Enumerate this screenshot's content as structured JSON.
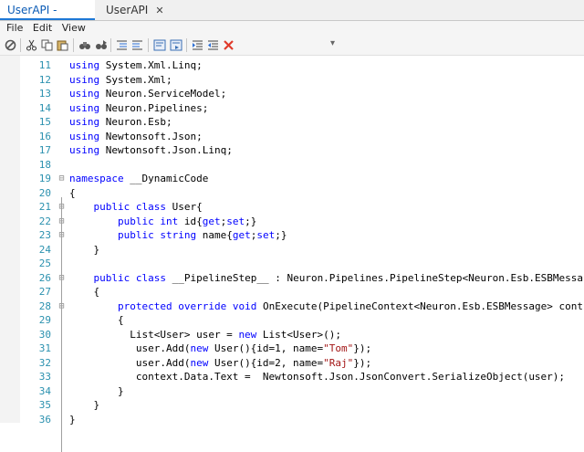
{
  "tabs": [
    {
      "label": "UserAPI - Get",
      "close": "✕"
    },
    {
      "label": "UserAPI",
      "close": "✕"
    }
  ],
  "menu": [
    "File",
    "Edit",
    "View"
  ],
  "toolbar_icons": [
    "no-icon",
    "cut-icon",
    "copy-icon",
    "paste-icon",
    "find-icon",
    "find-next-icon",
    "comment-icon",
    "uncomment-icon",
    "bookmark-icon",
    "bookmark-next-icon",
    "indent-icon",
    "outdent-icon",
    "delete-icon"
  ],
  "toolbar_chevron": "▾",
  "colors": {
    "keyword": "#0000ff",
    "string": "#a31515",
    "linenumber": "#2b91af",
    "tab_active": "#0b5bb5"
  },
  "code_lines": [
    {
      "n": "11",
      "fold": "",
      "segs": [
        {
          "t": "using",
          "k": "kw"
        },
        {
          "t": " System.Xml.Linq;",
          "k": ""
        }
      ]
    },
    {
      "n": "12",
      "fold": "",
      "segs": [
        {
          "t": "using",
          "k": "kw"
        },
        {
          "t": " System.Xml;",
          "k": ""
        }
      ]
    },
    {
      "n": "13",
      "fold": "",
      "segs": [
        {
          "t": "using",
          "k": "kw"
        },
        {
          "t": " Neuron.ServiceModel;",
          "k": ""
        }
      ]
    },
    {
      "n": "14",
      "fold": "",
      "segs": [
        {
          "t": "using",
          "k": "kw"
        },
        {
          "t": " Neuron.Pipelines;",
          "k": ""
        }
      ]
    },
    {
      "n": "15",
      "fold": "",
      "segs": [
        {
          "t": "using",
          "k": "kw"
        },
        {
          "t": " Neuron.Esb;",
          "k": ""
        }
      ]
    },
    {
      "n": "16",
      "fold": "",
      "segs": [
        {
          "t": "using",
          "k": "kw"
        },
        {
          "t": " Newtonsoft.Json;",
          "k": ""
        }
      ]
    },
    {
      "n": "17",
      "fold": "",
      "segs": [
        {
          "t": "using",
          "k": "kw"
        },
        {
          "t": " Newtonsoft.Json.Linq;",
          "k": ""
        }
      ]
    },
    {
      "n": "18",
      "fold": "",
      "segs": []
    },
    {
      "n": "19",
      "fold": "⊟",
      "segs": [
        {
          "t": "namespace",
          "k": "kw"
        },
        {
          "t": " __DynamicCode",
          "k": ""
        }
      ]
    },
    {
      "n": "20",
      "fold": "",
      "segs": [
        {
          "t": "{",
          "k": ""
        }
      ]
    },
    {
      "n": "21",
      "fold": "⊟",
      "segs": [
        {
          "t": "    ",
          "k": ""
        },
        {
          "t": "public",
          "k": "kw"
        },
        {
          "t": " ",
          "k": ""
        },
        {
          "t": "class",
          "k": "kw"
        },
        {
          "t": " User{",
          "k": ""
        }
      ]
    },
    {
      "n": "22",
      "fold": "⊟",
      "segs": [
        {
          "t": "        ",
          "k": ""
        },
        {
          "t": "public",
          "k": "kw"
        },
        {
          "t": " ",
          "k": ""
        },
        {
          "t": "int",
          "k": "kw"
        },
        {
          "t": " id{",
          "k": ""
        },
        {
          "t": "get",
          "k": "kw"
        },
        {
          "t": ";",
          "k": ""
        },
        {
          "t": "set",
          "k": "kw"
        },
        {
          "t": ";}",
          "k": ""
        }
      ]
    },
    {
      "n": "23",
      "fold": "⊟",
      "segs": [
        {
          "t": "        ",
          "k": ""
        },
        {
          "t": "public",
          "k": "kw"
        },
        {
          "t": " ",
          "k": ""
        },
        {
          "t": "string",
          "k": "kw"
        },
        {
          "t": " name{",
          "k": ""
        },
        {
          "t": "get",
          "k": "kw"
        },
        {
          "t": ";",
          "k": ""
        },
        {
          "t": "set",
          "k": "kw"
        },
        {
          "t": ";}",
          "k": ""
        }
      ]
    },
    {
      "n": "24",
      "fold": "",
      "segs": [
        {
          "t": "    }",
          "k": ""
        }
      ]
    },
    {
      "n": "25",
      "fold": "",
      "segs": []
    },
    {
      "n": "26",
      "fold": "⊟",
      "segs": [
        {
          "t": "    ",
          "k": ""
        },
        {
          "t": "public",
          "k": "kw"
        },
        {
          "t": " ",
          "k": ""
        },
        {
          "t": "class",
          "k": "kw"
        },
        {
          "t": " __PipelineStep__ : Neuron.Pipelines.PipelineStep<Neuron.Esb.ESBMessa",
          "k": ""
        }
      ]
    },
    {
      "n": "27",
      "fold": "",
      "segs": [
        {
          "t": "    {",
          "k": ""
        }
      ]
    },
    {
      "n": "28",
      "fold": "⊟",
      "segs": [
        {
          "t": "        ",
          "k": ""
        },
        {
          "t": "protected",
          "k": "kw"
        },
        {
          "t": " ",
          "k": ""
        },
        {
          "t": "override",
          "k": "kw"
        },
        {
          "t": " ",
          "k": ""
        },
        {
          "t": "void",
          "k": "kw"
        },
        {
          "t": " OnExecute(PipelineContext<Neuron.Esb.ESBMessage> cont",
          "k": ""
        }
      ]
    },
    {
      "n": "29",
      "fold": "",
      "segs": [
        {
          "t": "        {",
          "k": ""
        }
      ]
    },
    {
      "n": "30",
      "fold": "",
      "segs": [
        {
          "t": "          List<User> user = ",
          "k": ""
        },
        {
          "t": "new",
          "k": "kw"
        },
        {
          "t": " List<User>();",
          "k": ""
        }
      ]
    },
    {
      "n": "31",
      "fold": "",
      "segs": [
        {
          "t": "           user.Add(",
          "k": ""
        },
        {
          "t": "new",
          "k": "kw"
        },
        {
          "t": " User(){id=1, name=",
          "k": ""
        },
        {
          "t": "\"Tom\"",
          "k": "str"
        },
        {
          "t": "});",
          "k": ""
        }
      ]
    },
    {
      "n": "32",
      "fold": "",
      "segs": [
        {
          "t": "           user.Add(",
          "k": ""
        },
        {
          "t": "new",
          "k": "kw"
        },
        {
          "t": " User(){id=2, name=",
          "k": ""
        },
        {
          "t": "\"Raj\"",
          "k": "str"
        },
        {
          "t": "});",
          "k": ""
        }
      ]
    },
    {
      "n": "33",
      "fold": "",
      "segs": [
        {
          "t": "           context.Data.Text =  Newtonsoft.Json.JsonConvert.SerializeObject(user);",
          "k": ""
        }
      ]
    },
    {
      "n": "34",
      "fold": "",
      "segs": [
        {
          "t": "        }",
          "k": ""
        }
      ]
    },
    {
      "n": "35",
      "fold": "",
      "segs": [
        {
          "t": "    }",
          "k": ""
        }
      ]
    },
    {
      "n": "36",
      "fold": "",
      "segs": [
        {
          "t": "}",
          "k": ""
        }
      ]
    }
  ]
}
